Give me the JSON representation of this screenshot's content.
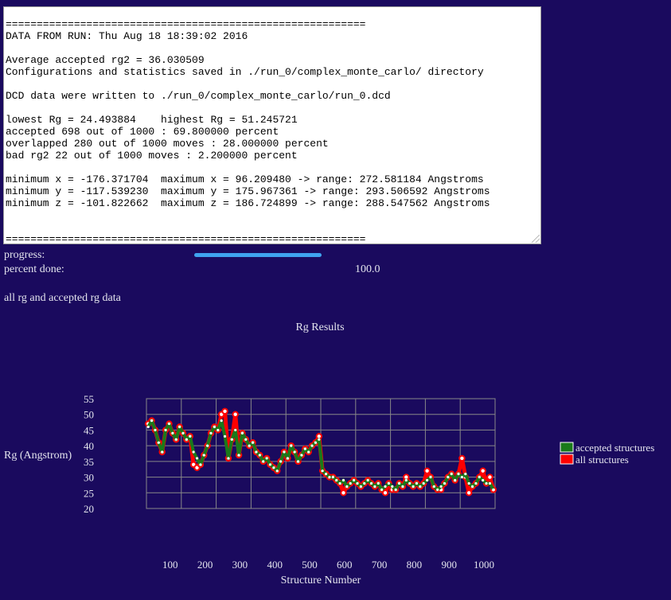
{
  "log": {
    "lines": [
      "==========================================================",
      "DATA FROM RUN: Thu Aug 18 18:39:02 2016",
      "",
      "Average accepted rg2 = 36.030509",
      "Configurations and statistics saved in ./run_0/complex_monte_carlo/ directory",
      "",
      "DCD data were written to ./run_0/complex_monte_carlo/run_0.dcd",
      "",
      "lowest Rg = 24.493884    highest Rg = 51.245721",
      "accepted 698 out of 1000 : 69.800000 percent",
      "overlapped 280 out of 1000 moves : 28.000000 percent",
      "bad rg2 22 out of 1000 moves : 2.200000 percent",
      "",
      "minimum x = -176.371704  maximum x = 96.209480 -> range: 272.581184 Angstroms",
      "minimum y = -117.539230  maximum y = 175.967361 -> range: 293.506592 Angstroms",
      "minimum z = -101.822662  maximum z = 186.724899 -> range: 288.547562 Angstroms",
      "",
      "",
      "=========================================================="
    ]
  },
  "progress": {
    "label": "progress:",
    "fraction": 1.0,
    "percent_label": "percent done:",
    "percent_value": "100.0"
  },
  "section_heading": "all rg and accepted rg data",
  "colors": {
    "background": "#1a0a5e",
    "accepted": "#1a7a1a",
    "all": "#ff0000",
    "grid": "#888888",
    "progress": "#3fa3ef"
  },
  "chart_data": {
    "type": "line",
    "title": "Rg Results",
    "xlabel": "Structure Number",
    "ylabel": "Rg (Angstrom)",
    "xlim": [
      0,
      1000
    ],
    "ylim": [
      20,
      55
    ],
    "xticks": [
      100,
      200,
      300,
      400,
      500,
      600,
      700,
      800,
      900,
      1000
    ],
    "yticks": [
      20,
      25,
      30,
      35,
      40,
      45,
      50,
      55
    ],
    "grid": true,
    "legend_position": "right",
    "series": [
      {
        "name": "accepted structures",
        "color": "#1a7a1a",
        "x": [
          5,
          15,
          25,
          35,
          45,
          55,
          65,
          75,
          85,
          95,
          105,
          115,
          125,
          135,
          145,
          155,
          165,
          175,
          185,
          195,
          205,
          215,
          225,
          235,
          245,
          255,
          265,
          275,
          285,
          295,
          305,
          315,
          325,
          335,
          345,
          355,
          365,
          375,
          385,
          395,
          405,
          415,
          425,
          435,
          445,
          455,
          465,
          475,
          485,
          495,
          505,
          515,
          525,
          535,
          545,
          555,
          565,
          575,
          585,
          595,
          605,
          615,
          625,
          635,
          645,
          655,
          665,
          675,
          685,
          695,
          705,
          715,
          725,
          735,
          745,
          755,
          765,
          775,
          785,
          795,
          805,
          815,
          825,
          835,
          845,
          855,
          865,
          875,
          885,
          895,
          905,
          915,
          925,
          935,
          945,
          955,
          965,
          975,
          985,
          995
        ],
        "y": [
          46,
          48,
          45,
          41,
          38,
          45,
          47,
          44,
          42,
          46,
          44,
          42,
          43,
          38,
          36,
          34,
          37,
          40,
          44,
          46,
          45,
          48,
          43,
          36,
          42,
          45,
          37,
          44,
          42,
          40,
          41,
          38,
          37,
          35,
          36,
          34,
          33,
          32,
          35,
          38,
          36,
          40,
          38,
          35,
          37,
          39,
          38,
          40,
          41,
          42,
          32,
          31,
          30,
          30,
          29,
          28,
          29,
          27,
          28,
          29,
          28,
          27,
          28,
          29,
          28,
          27,
          28,
          26,
          27,
          28,
          27,
          26,
          28,
          27,
          29,
          28,
          27,
          28,
          27,
          28,
          29,
          30,
          27,
          26,
          27,
          28,
          30,
          31,
          29,
          31,
          30,
          31,
          28,
          27,
          28,
          30,
          29,
          28,
          28,
          26
        ]
      },
      {
        "name": "all structures",
        "color": "#ff0000",
        "x": [
          5,
          15,
          25,
          35,
          45,
          55,
          65,
          75,
          85,
          95,
          105,
          115,
          125,
          135,
          145,
          155,
          165,
          175,
          185,
          195,
          205,
          215,
          225,
          235,
          245,
          255,
          265,
          275,
          285,
          295,
          305,
          315,
          325,
          335,
          345,
          355,
          365,
          375,
          385,
          395,
          405,
          415,
          425,
          435,
          445,
          455,
          465,
          475,
          485,
          495,
          505,
          515,
          525,
          535,
          545,
          555,
          565,
          575,
          585,
          595,
          605,
          615,
          625,
          635,
          645,
          655,
          665,
          675,
          685,
          695,
          705,
          715,
          725,
          735,
          745,
          755,
          765,
          775,
          785,
          795,
          805,
          815,
          825,
          835,
          845,
          855,
          865,
          875,
          885,
          895,
          905,
          915,
          925,
          935,
          945,
          955,
          965,
          975,
          985,
          995
        ],
        "y": [
          47,
          48,
          45,
          41,
          38,
          45,
          47,
          44,
          42,
          46,
          44,
          42,
          43,
          34,
          33,
          34,
          37,
          40,
          44,
          46,
          45,
          50,
          51,
          36,
          42,
          50,
          37,
          44,
          42,
          40,
          41,
          38,
          37,
          35,
          36,
          34,
          33,
          32,
          35,
          38,
          36,
          40,
          38,
          35,
          37,
          39,
          38,
          40,
          41,
          43,
          32,
          31,
          30,
          30,
          29,
          28,
          25,
          27,
          28,
          29,
          28,
          27,
          28,
          29,
          28,
          27,
          28,
          26,
          25,
          28,
          26,
          26,
          28,
          27,
          30,
          28,
          27,
          28,
          27,
          28,
          32,
          30,
          27,
          26,
          26,
          28,
          30,
          31,
          29,
          31,
          36,
          30,
          25,
          27,
          28,
          30,
          32,
          28,
          30,
          26
        ]
      }
    ]
  }
}
